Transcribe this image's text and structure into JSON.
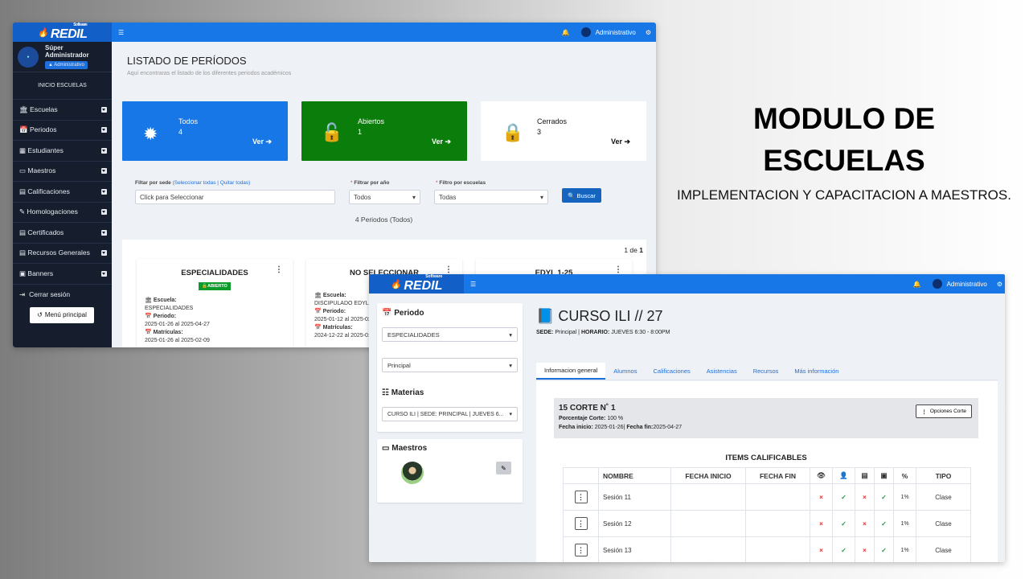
{
  "promo": {
    "title1": "MODULO DE",
    "title2": "ESCUELAS",
    "subtitle": "IMPLEMENTACION Y CAPACITACION A MAESTROS."
  },
  "app": {
    "brand_small": "Software",
    "brand": "REDIL",
    "menu_icon": "☰",
    "bell": "🔔",
    "user": "Administrativo",
    "gear": "⚙"
  },
  "w1": {
    "profile": {
      "name": "Súper Administrador",
      "role": "Administrativo"
    },
    "inicio": "INICIO ESCUELAS",
    "nav": [
      {
        "icon": "🏛",
        "label": "Escuelas"
      },
      {
        "icon": "📅",
        "label": "Periodos"
      },
      {
        "icon": "▦",
        "label": "Estudiantes"
      },
      {
        "icon": "▭",
        "label": "Maestros"
      },
      {
        "icon": "▤",
        "label": "Calificaciones"
      },
      {
        "icon": "✎",
        "label": "Homologaciones"
      },
      {
        "icon": "▤",
        "label": "Certificados"
      },
      {
        "icon": "▤",
        "label": "Recursos Generales"
      },
      {
        "icon": "▣",
        "label": "Banners"
      }
    ],
    "logout": "Cerrar sesión",
    "menu_btn": "Menú principal",
    "page_title": "LISTADO DE PERÍODOS",
    "page_sub": "Aquí encontraras el listado de los diferentes periodos académicos",
    "cards": [
      {
        "title": "Todos",
        "count": "4",
        "link": "Ver"
      },
      {
        "title": "Abiertos",
        "count": "1",
        "link": "Ver"
      },
      {
        "title": "Cerrados",
        "count": "3",
        "link": "Ver"
      }
    ],
    "filters": {
      "sede_label": "Filtar por sede",
      "sel_all": "(Seleccionar todas",
      "sep": " | ",
      "quit_all": "Quitar todas)",
      "sede_ph": "Click para Seleccionar",
      "year_label": "Filtrar por año",
      "year_val": "Todos",
      "school_label": "Filtro por escuelas",
      "school_val": "Todas",
      "search": "Buscar"
    },
    "result": "4 Periodos (Todos)",
    "pager": "1 de",
    "pager_n": "1",
    "periods": [
      {
        "name": "ESPECIALIDADES",
        "badge": "ABIERTO",
        "esc_l": "Escuela:",
        "esc": "ESPECIALIDADES",
        "per_l": "Periodo:",
        "per": "2025-01-26 al 2025-04-27",
        "mat_l": "Matrículas:",
        "mat": "2025-01-26 al 2025-02-09"
      },
      {
        "name": "NO SELECCIONAR",
        "esc_l": "Escuela:",
        "esc": "DISCIPULADO EDYL",
        "per_l": "Periodo:",
        "per": "2025-01-12 al 2025-02-",
        "mat_l": "Matrículas:",
        "mat": "2024-12-22 al 2025-01-"
      },
      {
        "name": "EDYL 1-25"
      }
    ]
  },
  "w2": {
    "periodo_label": "Periodo",
    "periodo_val": "ESPECIALIDADES",
    "sede_val": "Principal",
    "materias_label": "Materias",
    "materia_val": "CURSO ILI | SEDE: PRINCIPAL | JUEVES 6...",
    "maestros_label": "Maestros",
    "course_title": "CURSO ILI // 27",
    "course_meta_sede_l": "SEDE:",
    "course_meta_sede": "Principal",
    "course_meta_hor_l": "HORARIO:",
    "course_meta_hor": "JUEVES 6:30 - 8:00PM",
    "tabs": [
      "Informacion general",
      "Alumnos",
      "Calificaciones",
      "Asistencias",
      "Recursos",
      "Más información"
    ],
    "corte_title": "15 CORTE N˚ 1",
    "pct_l": "Porcentaje Corte:",
    "pct": "100 %",
    "fi_l": "Fecha inicio:",
    "fi": "2025-01-26",
    "ff_l": "Fecha fin:",
    "ff": "2025-04-27",
    "opciones": "Opciones Corte",
    "items_title": "ITEMS CALIFICABLES",
    "cols": [
      "NOMBRE",
      "FECHA INICIO",
      "FECHA FIN",
      "TIPO"
    ],
    "col_icons": [
      "👁",
      "👤",
      "▤",
      "▣",
      "%"
    ],
    "rows": [
      {
        "name": "Sesión 11",
        "marks": [
          "×",
          "✓",
          "×",
          "✓"
        ],
        "pct": "1%",
        "tipo": "Clase"
      },
      {
        "name": "Sesión 12",
        "marks": [
          "×",
          "✓",
          "×",
          "✓"
        ],
        "pct": "1%",
        "tipo": "Clase"
      },
      {
        "name": "Sesión 13",
        "marks": [
          "×",
          "✓",
          "×",
          "✓"
        ],
        "pct": "1%",
        "tipo": "Clase"
      }
    ]
  }
}
